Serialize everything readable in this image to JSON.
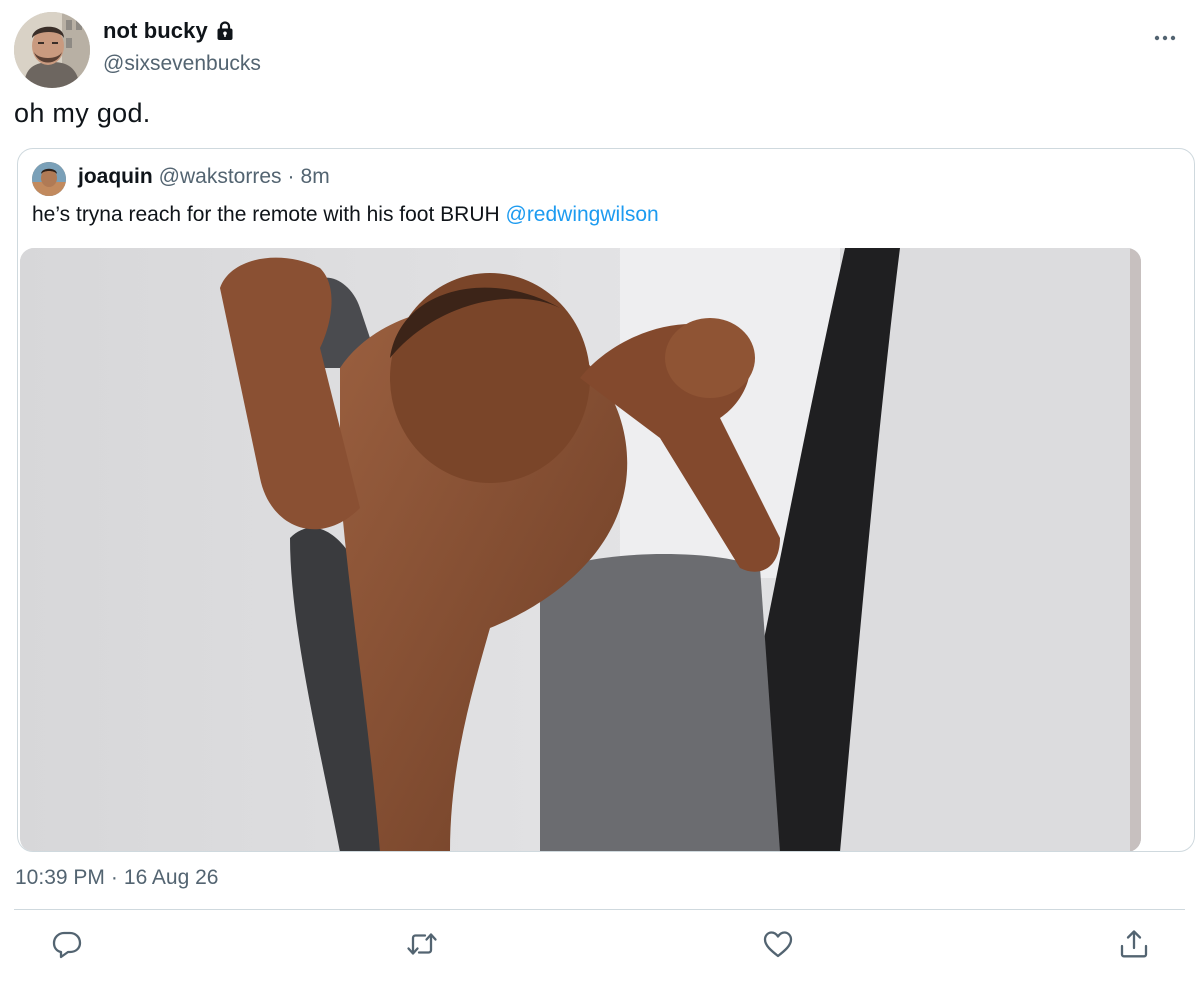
{
  "author": {
    "display_name": "not bucky",
    "handle": "@sixsevenbucks",
    "protected_icon": "lock-icon",
    "avatar_icon": "profile-photo"
  },
  "tweet": {
    "text": "oh my god.",
    "time": "10:39 PM",
    "separator": "·",
    "date": "16 Aug 26"
  },
  "quoted": {
    "display_name": "joaquin",
    "handle": "@wakstorres",
    "separator": "·",
    "time": "8m",
    "text": "he’s tryna reach for the remote with his foot BRUH",
    "mention": "@redwingwilson",
    "media_icon": "photo"
  },
  "actions": {
    "reply_icon": "reply-icon",
    "retweet_icon": "retweet-icon",
    "like_icon": "like-icon",
    "share_icon": "share-icon",
    "more_icon": "more-icon"
  },
  "colors": {
    "text": "#0f1419",
    "secondary": "#536471",
    "link": "#1d9bf0",
    "border": "#cfd9de"
  }
}
